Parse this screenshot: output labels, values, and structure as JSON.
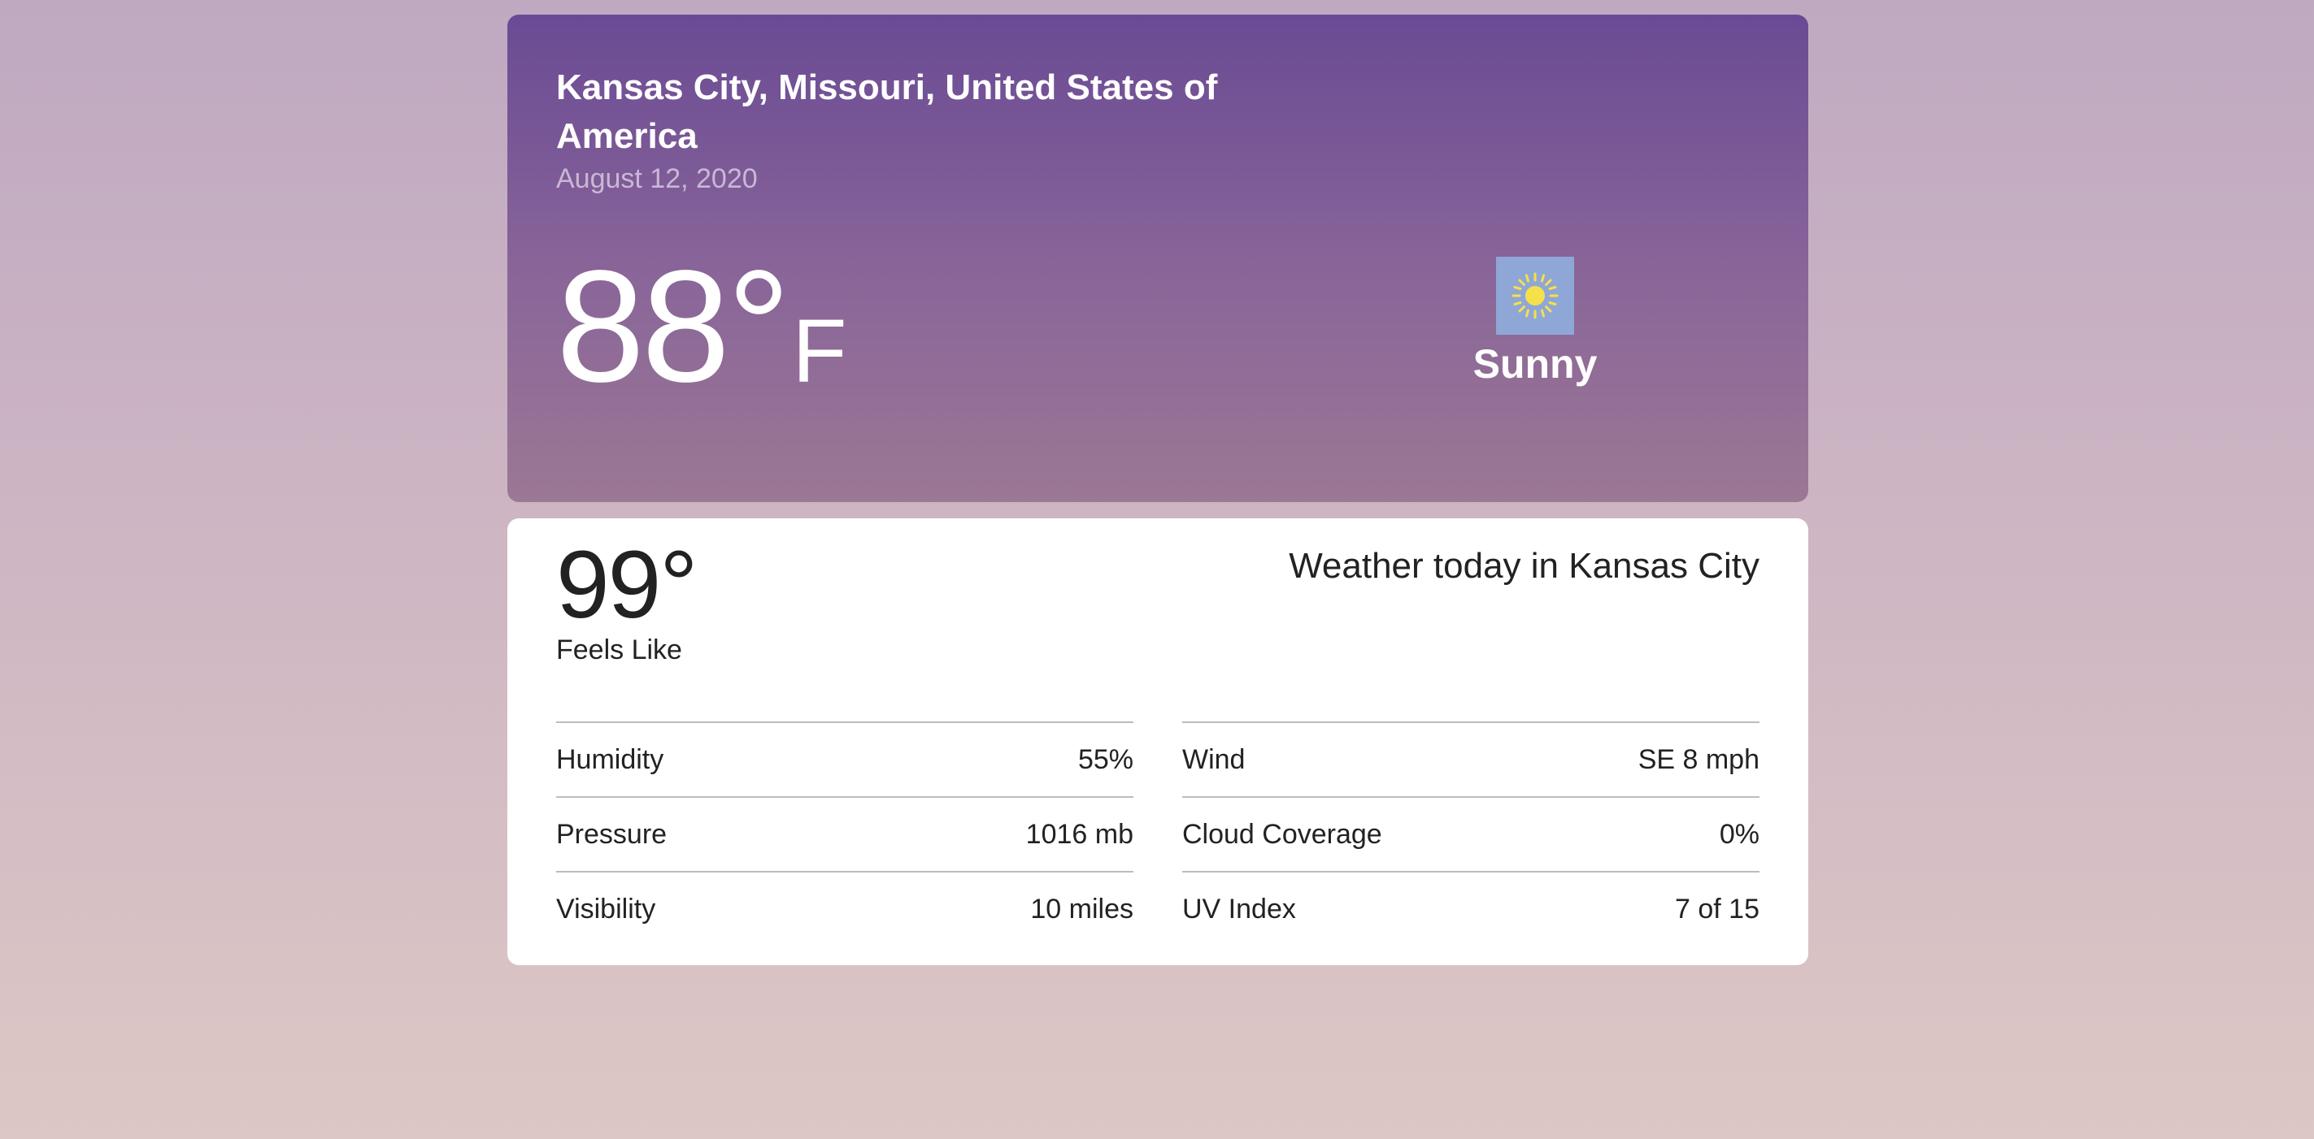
{
  "header": {
    "location": "Kansas City, Missouri, United States of America",
    "date": "August 12, 2020",
    "temperature": "88°",
    "unit": "F",
    "condition": "Sunny",
    "condition_icon": "sun-icon",
    "condition_icon_bg": "#8fa7d6"
  },
  "details": {
    "feels_like_value": "99°",
    "feels_like_label": "Feels Like",
    "title": "Weather today in Kansas City",
    "left": [
      {
        "label": "Humidity",
        "value": "55%"
      },
      {
        "label": "Pressure",
        "value": "1016 mb"
      },
      {
        "label": "Visibility",
        "value": "10 miles"
      }
    ],
    "right": [
      {
        "label": "Wind",
        "value": "SE 8 mph"
      },
      {
        "label": "Cloud Coverage",
        "value": "0%"
      },
      {
        "label": "UV Index",
        "value": "7 of 15"
      }
    ]
  },
  "colors": {
    "hero_top": "#6a4a94",
    "hero_bottom": "#9b7894",
    "sun": "#f5e04a"
  }
}
